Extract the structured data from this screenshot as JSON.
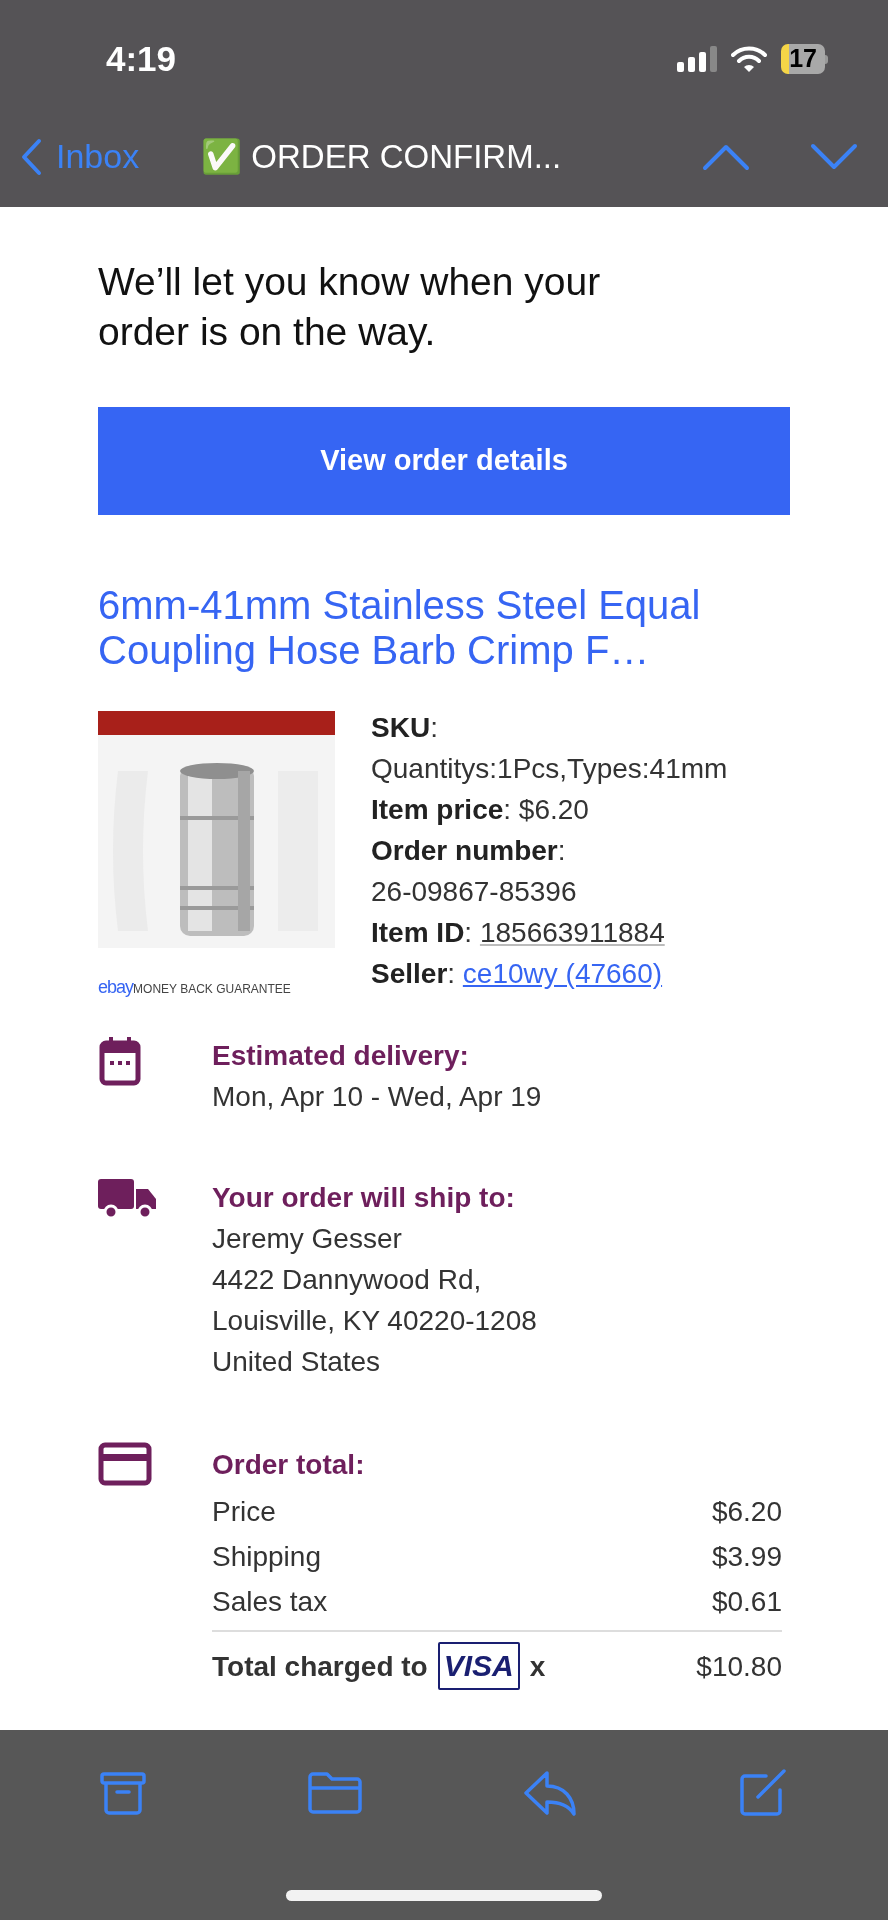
{
  "status_bar": {
    "time": "4:19",
    "battery": "17"
  },
  "nav": {
    "back": "Inbox",
    "title": "✅ ORDER CONFIRM..."
  },
  "intro": "We’ll let you know when your order is on the way.",
  "button": "View order details",
  "product": {
    "title": "6mm-41mm Stainless Steel Equal Coupling Hose Barb Crimp F…",
    "guarantee": {
      "logo": "ebay",
      "text": "MONEY BACK GUARANTEE"
    },
    "details": [
      {
        "label": "SKU",
        "sep": ":"
      },
      {
        "value": "Quantitys:1Pcs,Types:41mm"
      },
      {
        "label": "Item price",
        "sep": ":",
        "value": "$6.20"
      },
      {
        "label": "Order number",
        "sep": ":"
      },
      {
        "value": "26-09867-85396"
      },
      {
        "label": "Item ID",
        "sep": ":",
        "value": "185663911884",
        "kind": "underlined"
      },
      {
        "label": "Seller",
        "sep": ":",
        "value": "ce10wy (47660)",
        "kind": "link"
      }
    ]
  },
  "sections": [
    {
      "kind": "calendar",
      "title": "Estimated delivery:",
      "lines": [
        "Mon, Apr 10 - Wed, Apr 19"
      ]
    },
    {
      "kind": "truck",
      "title": "Your order will ship to:",
      "lines": [
        "Jeremy Gesser",
        "4422 Dannywood Rd,",
        "Louisville, KY 40220-1208",
        "United States"
      ]
    }
  ],
  "order_total": {
    "title": "Order total:",
    "rows": [
      {
        "label": "Price",
        "amount": "$6.20"
      },
      {
        "label": "Shipping",
        "amount": "$3.99"
      },
      {
        "label": "Sales tax",
        "amount": "$0.61"
      }
    ],
    "total": {
      "label": "Total charged to",
      "card": "VISA",
      "suffix": "x",
      "amount": "$10.80"
    }
  }
}
